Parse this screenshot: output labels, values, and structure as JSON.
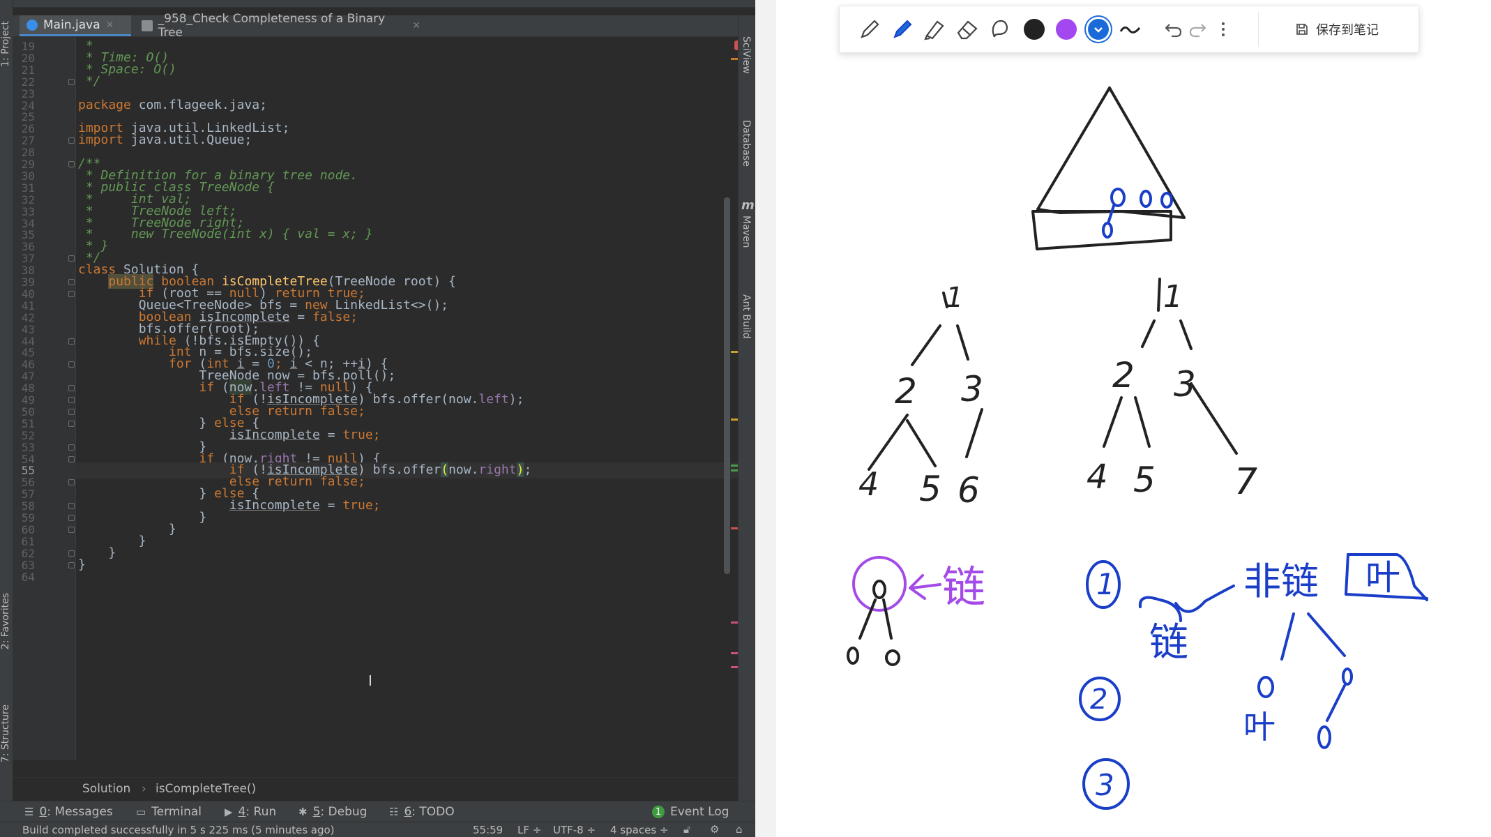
{
  "ide": {
    "tabs": [
      {
        "label": "Main.java",
        "active": true
      },
      {
        "label": "_958_Check Completeness of a Binary Tree",
        "active": false
      }
    ],
    "left_panels": [
      "1: Project",
      "2: Favorites",
      "7: Structure"
    ],
    "right_panels": [
      "SciView",
      "Database",
      "Maven",
      "Ant Build"
    ],
    "maven_letter": "m",
    "line_numbers": [
      "19",
      "20",
      "21",
      "22",
      "23",
      "24",
      "25",
      "26",
      "27",
      "28",
      "29",
      "30",
      "31",
      "32",
      "33",
      "34",
      "35",
      "36",
      "37",
      "38",
      "39",
      "40",
      "41",
      "42",
      "43",
      "44",
      "45",
      "46",
      "47",
      "48",
      "49",
      "50",
      "51",
      "52",
      "53",
      "54",
      "55",
      "56",
      "57",
      "58",
      "59",
      "60",
      "61",
      "62",
      "63",
      "64"
    ],
    "current_line": "55",
    "code_tokens": {
      "l19": [
        {
          "t": " *",
          "c": "cm"
        }
      ],
      "l20": [
        {
          "t": " * Time: O()",
          "c": "cm"
        }
      ],
      "l21": [
        {
          "t": " * Space: O()",
          "c": "cm"
        }
      ],
      "l22": [
        {
          "t": " */",
          "c": "cm"
        }
      ],
      "l23": [],
      "l24": [
        {
          "t": "package",
          "c": "kw"
        },
        {
          "t": " com.flageek.java;",
          "c": ""
        }
      ],
      "l25": [],
      "l26": [
        {
          "t": "import",
          "c": "kw"
        },
        {
          "t": " java.util.LinkedList;",
          "c": ""
        }
      ],
      "l27": [
        {
          "t": "import",
          "c": "kw"
        },
        {
          "t": " java.util.Queue;",
          "c": ""
        }
      ],
      "l28": [],
      "l29": [
        {
          "t": "/**",
          "c": "cm"
        }
      ],
      "l30": [
        {
          "t": " * Definition for a binary tree node.",
          "c": "cm"
        }
      ],
      "l31": [
        {
          "t": " * public class TreeNode {",
          "c": "cm"
        }
      ],
      "l32": [
        {
          "t": " *     int val;",
          "c": "cm"
        }
      ],
      "l33": [
        {
          "t": " *     TreeNode left;",
          "c": "cm"
        }
      ],
      "l34": [
        {
          "t": " *     TreeNode right;",
          "c": "cm"
        }
      ],
      "l35": [
        {
          "t": " *     new TreeNode(int x) { val = x; }",
          "c": "cm"
        }
      ],
      "l36": [
        {
          "t": " * }",
          "c": "cm"
        }
      ],
      "l37": [
        {
          "t": " */",
          "c": "cm"
        }
      ],
      "l38": [
        {
          "t": "class",
          "c": "kw"
        },
        {
          "t": " Solution {",
          "c": ""
        }
      ],
      "l39": [
        {
          "t": "    ",
          "c": ""
        },
        {
          "t": "public",
          "c": "kw hlpub"
        },
        {
          "t": " boolean",
          "c": "kw"
        },
        {
          "t": " ",
          "c": ""
        },
        {
          "t": "isCompleteTree",
          "c": "fn"
        },
        {
          "t": "(TreeNode root) {",
          "c": ""
        }
      ],
      "l40": [
        {
          "t": "        ",
          "c": ""
        },
        {
          "t": "if",
          "c": "kw"
        },
        {
          "t": " (root == ",
          "c": ""
        },
        {
          "t": "null",
          "c": "kw"
        },
        {
          "t": ") ",
          "c": ""
        },
        {
          "t": "return true",
          "c": "kw"
        },
        {
          "t": ";",
          "c": "kw"
        }
      ],
      "l41": [
        {
          "t": "        Queue<TreeNode> bfs = ",
          "c": ""
        },
        {
          "t": "new",
          "c": "kw"
        },
        {
          "t": " LinkedList<>();",
          "c": ""
        }
      ],
      "l42": [
        {
          "t": "        ",
          "c": ""
        },
        {
          "t": "boolean",
          "c": "kw"
        },
        {
          "t": " ",
          "c": ""
        },
        {
          "t": "isIncomplete",
          "c": "und"
        },
        {
          "t": " = ",
          "c": ""
        },
        {
          "t": "false",
          "c": "kw"
        },
        {
          "t": ";",
          "c": "kw"
        }
      ],
      "l43": [
        {
          "t": "        bfs.offer(root);",
          "c": ""
        }
      ],
      "l44": [
        {
          "t": "        ",
          "c": ""
        },
        {
          "t": "while",
          "c": "kw"
        },
        {
          "t": " (!bfs.isEmpty()) {",
          "c": ""
        }
      ],
      "l45": [
        {
          "t": "            ",
          "c": ""
        },
        {
          "t": "int",
          "c": "kw"
        },
        {
          "t": " n = bfs.size();",
          "c": ""
        }
      ],
      "l46": [
        {
          "t": "            ",
          "c": ""
        },
        {
          "t": "for",
          "c": "kw"
        },
        {
          "t": " (",
          "c": ""
        },
        {
          "t": "int",
          "c": "kw"
        },
        {
          "t": " ",
          "c": ""
        },
        {
          "t": "i",
          "c": "und"
        },
        {
          "t": " = ",
          "c": ""
        },
        {
          "t": "0",
          "c": "num"
        },
        {
          "t": "; ",
          "c": "kw"
        },
        {
          "t": "i",
          "c": "und"
        },
        {
          "t": " < n; ++",
          "c": ""
        },
        {
          "t": "i",
          "c": "und"
        },
        {
          "t": ") {",
          "c": ""
        }
      ],
      "l47": [
        {
          "t": "                TreeNode now = bfs.poll();",
          "c": ""
        }
      ],
      "l48": [
        {
          "t": "                ",
          "c": ""
        },
        {
          "t": "if",
          "c": "kw"
        },
        {
          "t": " (",
          "c": ""
        },
        {
          "t": "now",
          "c": "hl"
        },
        {
          "t": ".",
          "c": ""
        },
        {
          "t": "left",
          "c": "fld"
        },
        {
          "t": " != ",
          "c": ""
        },
        {
          "t": "null",
          "c": "kw"
        },
        {
          "t": ") {",
          "c": ""
        }
      ],
      "l49": [
        {
          "t": "                    ",
          "c": ""
        },
        {
          "t": "if",
          "c": "kw"
        },
        {
          "t": " (!",
          "c": ""
        },
        {
          "t": "isIncomplete",
          "c": "und"
        },
        {
          "t": ") bfs.offer(now.",
          "c": ""
        },
        {
          "t": "left",
          "c": "fld"
        },
        {
          "t": ");",
          "c": ""
        }
      ],
      "l50": [
        {
          "t": "                    ",
          "c": ""
        },
        {
          "t": "else return false",
          "c": "kw"
        },
        {
          "t": ";",
          "c": "kw"
        }
      ],
      "l51": [
        {
          "t": "                } ",
          "c": ""
        },
        {
          "t": "else",
          "c": "kw"
        },
        {
          "t": " {",
          "c": ""
        }
      ],
      "l52": [
        {
          "t": "                    ",
          "c": ""
        },
        {
          "t": "isIncomplete",
          "c": "und"
        },
        {
          "t": " = ",
          "c": ""
        },
        {
          "t": "true",
          "c": "kw"
        },
        {
          "t": ";",
          "c": "kw"
        }
      ],
      "l53": [
        {
          "t": "                }",
          "c": ""
        }
      ],
      "l54": [
        {
          "t": "                ",
          "c": ""
        },
        {
          "t": "if",
          "c": "kw"
        },
        {
          "t": " (now.",
          "c": ""
        },
        {
          "t": "right",
          "c": "fld"
        },
        {
          "t": " != ",
          "c": ""
        },
        {
          "t": "null",
          "c": "kw"
        },
        {
          "t": ") {",
          "c": ""
        }
      ],
      "l55": [
        {
          "t": "                    ",
          "c": ""
        },
        {
          "t": "if",
          "c": "kw"
        },
        {
          "t": " (!",
          "c": ""
        },
        {
          "t": "isIncomplete",
          "c": "und"
        },
        {
          "t": ") bfs.offer",
          "c": ""
        },
        {
          "t": "(",
          "c": "brk"
        },
        {
          "t": "now.",
          "c": ""
        },
        {
          "t": "right",
          "c": "fld"
        },
        {
          "t": ")",
          "c": "brk"
        },
        {
          "t": ";",
          "c": ""
        }
      ],
      "l56": [
        {
          "t": "                    ",
          "c": ""
        },
        {
          "t": "else return false",
          "c": "kw"
        },
        {
          "t": ";",
          "c": "kw"
        }
      ],
      "l57": [
        {
          "t": "                } ",
          "c": ""
        },
        {
          "t": "else",
          "c": "kw"
        },
        {
          "t": " {",
          "c": ""
        }
      ],
      "l58": [
        {
          "t": "                    ",
          "c": ""
        },
        {
          "t": "isIncomplete",
          "c": "und"
        },
        {
          "t": " = ",
          "c": ""
        },
        {
          "t": "true;",
          "c": "kw"
        }
      ],
      "l59": [
        {
          "t": "                }",
          "c": ""
        }
      ],
      "l60": [
        {
          "t": "            }",
          "c": ""
        }
      ],
      "l61": [
        {
          "t": "        }",
          "c": ""
        }
      ],
      "l62": [
        {
          "t": "    }",
          "c": ""
        }
      ],
      "l63": [
        {
          "t": "}",
          "c": ""
        }
      ],
      "l64": []
    },
    "breadcrumb": {
      "class": "Solution",
      "method": "isCompleteTree()"
    },
    "tool_windows": [
      {
        "key": "0",
        "label": "Messages"
      },
      {
        "key": "",
        "label": "Terminal"
      },
      {
        "key": "4",
        "label": "Run"
      },
      {
        "key": "5",
        "label": "Debug"
      },
      {
        "key": "6",
        "label": "TODO"
      }
    ],
    "event_log": {
      "count": "1",
      "label": "Event Log"
    },
    "status": {
      "message": "Build completed successfully in 5 s 225 ms (5 minutes ago)",
      "position": "55:59",
      "line_sep": "LF",
      "encoding": "UTF-8",
      "indent": "4 spaces"
    }
  },
  "notes": {
    "save_label": "保存到笔记",
    "pen_colors": {
      "black": "#222222",
      "purple": "#a347f0",
      "blue": "#1a6bd9"
    },
    "ink_colors": {
      "blue": "#1a3ec8",
      "purple": "#a34ae8",
      "dark": "#222222"
    },
    "handwriting": {
      "root_left": "1",
      "n2_left": "2",
      "n3_left": "3",
      "n4_left": "4",
      "n5_left": "5",
      "n6_left": "6",
      "root_right": "1",
      "n2_right": "2",
      "n3_right": "3",
      "n4_right": "4",
      "n5_right": "5",
      "n7_right": "7",
      "chain_label": "链",
      "case_1": "1",
      "case_2": "2",
      "case_3": "3",
      "chain_word": "链",
      "non_chain": "非链",
      "leaf": "叶",
      "leaf_small": "叶"
    }
  }
}
